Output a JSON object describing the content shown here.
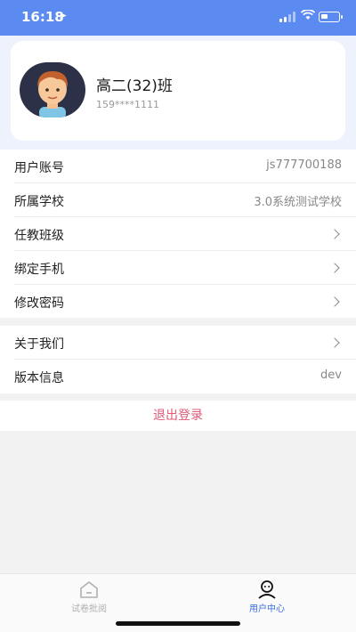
{
  "status_bar": {
    "time": "16:18",
    "location_icon": "location-arrow-icon",
    "signal_icon": "signal-icon",
    "wifi_icon": "wifi-icon",
    "battery_icon": "battery-icon"
  },
  "profile": {
    "class_name": "高二(32)班",
    "phone": "159****1111",
    "avatar_icon": "cartoon-boy-avatar"
  },
  "settings": [
    {
      "label": "用户账号",
      "value": "js777700188"
    },
    {
      "label": "所属学校",
      "value": "3.0系统测试学校"
    },
    {
      "label": "任教班级",
      "icon": "chevron-right-icon"
    },
    {
      "label": "绑定手机",
      "icon": "chevron-right-icon"
    },
    {
      "label": "修改密码",
      "icon": "chevron-right-icon"
    }
  ],
  "about": [
    {
      "label": "关于我们",
      "icon": "chevron-right-icon"
    },
    {
      "label": "版本信息",
      "value": "dev"
    }
  ],
  "logout_label": "退出登录",
  "tabbar": {
    "tabs": [
      {
        "label": "试卷批阅",
        "icon": "home-icon",
        "active": false
      },
      {
        "label": "用户中心",
        "icon": "user-icon",
        "active": true
      }
    ]
  },
  "colors": {
    "header_blue": "#5b8bf0",
    "active_tab": "#3b6fe0",
    "logout_red": "#e05a77"
  }
}
